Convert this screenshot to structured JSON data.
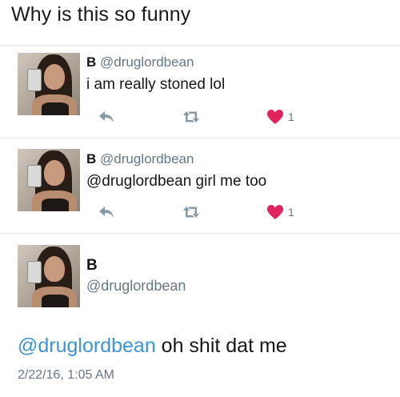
{
  "caption": "Why is this so funny",
  "colors": {
    "like": "#e0245e",
    "action_gray": "#8899a6",
    "link": "#3b94d9"
  },
  "icons": {
    "reply": "reply-icon",
    "retweet": "retweet-icon",
    "like": "heart-icon"
  },
  "tweets": [
    {
      "name": "B",
      "handle": "@druglordbean",
      "text": "i am really stoned lol",
      "likes": "1"
    },
    {
      "name": "B",
      "handle": "@druglordbean",
      "text": "@druglordbean girl me too",
      "likes": "1"
    }
  ],
  "main_tweet": {
    "name": "B",
    "handle": "@druglordbean",
    "mention": "@druglordbean",
    "text": " oh shit dat me",
    "timestamp": "2/22/16, 1:05 AM"
  }
}
